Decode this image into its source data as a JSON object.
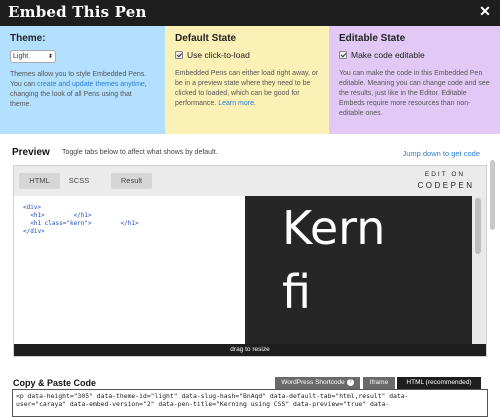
{
  "title": "Embed This Pen",
  "theme": {
    "heading": "Theme:",
    "selected": "Light",
    "text_before": "Themes allow you to style Embedded Pens. You can ",
    "link": "create and update themes anytime",
    "text_after": ", changing the look of all Pens using that theme."
  },
  "default_state": {
    "heading": "Default State",
    "checkbox_label": "Use click-to-load",
    "checked": true,
    "text": "Embedded Pens can either load right away, or be in a preview state where they need to be clicked to loaded, which can be good for performance. ",
    "link": "Learn more."
  },
  "editable_state": {
    "heading": "Editable State",
    "checkbox_label": "Make code editable",
    "checked": true,
    "text": "You can make the code in this Embedded Pen editable. Meaning you can change code and see the results, just like in the Editor. Editable Embeds require more resources than non-editable ones."
  },
  "preview": {
    "heading": "Preview",
    "subtitle": "Toggle tabs below to affect what shows by default.",
    "jump_link": "Jump down to get code",
    "tabs": [
      "HTML",
      "SCSS",
      "Result"
    ],
    "edit_on": "EDIT ON",
    "brand": "CODEPEN",
    "code": "<div>\n  <h1>        </h1>\n  <h1 class=\"kern\">        </h1>\n</div>",
    "result_lines": [
      "Kern",
      "fi"
    ],
    "drag_label": "drag to resize"
  },
  "copy": {
    "heading": "Copy & Paste Code",
    "tabs": [
      "WordPress Shortcode",
      "Iframe",
      "HTML (recommended)"
    ],
    "help_icon": "?",
    "snippet": "<p data-height=\"305\" data-theme-id=\"light\" data-slug-hash=\"BnAqd\" data-default-tab=\"html,result\" data-\nuser=\"caraya\" data-embed-version=\"2\" data-pen-title=\"Kerning using CSS\" data-preview=\"true\" data-"
  }
}
